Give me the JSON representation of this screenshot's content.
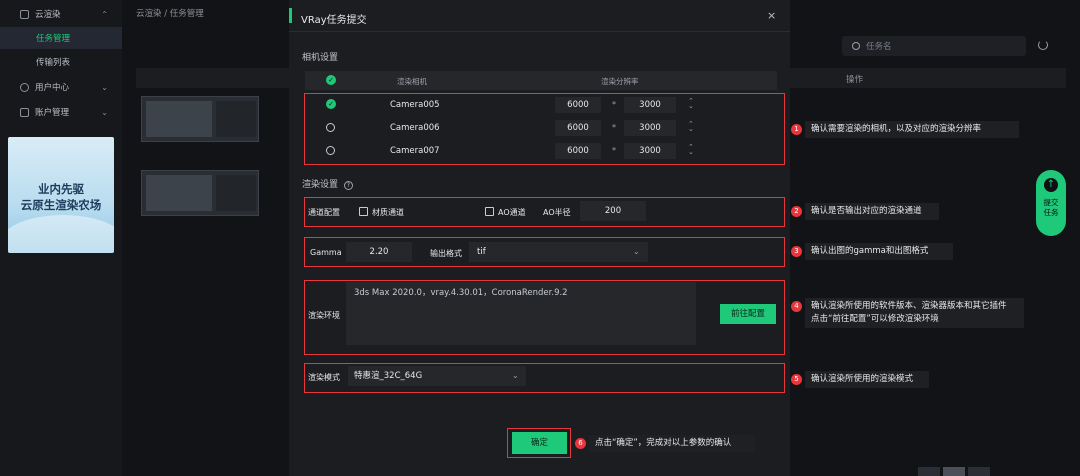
{
  "sidebar": {
    "items": [
      {
        "label": "云渲染",
        "chevron": "⌃"
      },
      {
        "label": "任务管理"
      },
      {
        "label": "传输列表"
      },
      {
        "label": "用户中心",
        "chevron": "⌄"
      },
      {
        "label": "账户管理",
        "chevron": "⌄"
      }
    ],
    "promo_line1": "业内先驱",
    "promo_line2": "云原生渲染农场"
  },
  "background": {
    "breadcrumb": "云渲染 / 任务管理",
    "search_placeholder": "任务名",
    "table_header_operation": "操作",
    "float_button": "提交任务"
  },
  "dialog": {
    "title": "VRay任务提交",
    "close": "×",
    "camera_section": "相机设置",
    "camera_header_camera": "渲染相机",
    "camera_header_resolution": "渲染分辨率",
    "cameras": [
      {
        "name": "Camera005",
        "width": "6000",
        "height": "3000",
        "selected": true
      },
      {
        "name": "Camera006",
        "width": "6000",
        "height": "3000",
        "selected": false
      },
      {
        "name": "Camera007",
        "width": "6000",
        "height": "3000",
        "selected": false
      }
    ],
    "times_symbol": "*",
    "render_section": "渲染设置",
    "channel_label": "通道配置",
    "material_channel": "材质通道",
    "ao_channel": "AO通道",
    "ao_radius_label": "AO半径",
    "ao_radius": "200",
    "gamma_label": "Gamma",
    "gamma_value": "2.20",
    "output_format_label": "输出格式",
    "output_format": "tif",
    "env_label": "渲染环境",
    "env_value": "3ds Max 2020.0，vray.4.30.01，CoronaRender.9.2",
    "env_button": "前往配置",
    "mode_label": "渲染模式",
    "mode_value": "特惠渲_32C_64G",
    "confirm_button": "确定"
  },
  "annotations": [
    {
      "num": "1",
      "text": "确认需要渲染的相机，以及对应的渲染分辨率"
    },
    {
      "num": "2",
      "text": "确认是否输出对应的渲染通道"
    },
    {
      "num": "3",
      "text": "确认出图的gamma和出图格式"
    },
    {
      "num": "4",
      "line1": "确认渲染所使用的软件版本、渲染器版本和其它插件",
      "line2": "点击“前往配置”可以修改渲染环境"
    },
    {
      "num": "5",
      "text": "确认渲染所使用的渲染模式"
    },
    {
      "num": "6",
      "text": "点击“确定”，完成对以上参数的确认"
    }
  ],
  "colors": {
    "accent": "#1ec979",
    "highlight": "#e8363d",
    "background": "#0f1013"
  }
}
